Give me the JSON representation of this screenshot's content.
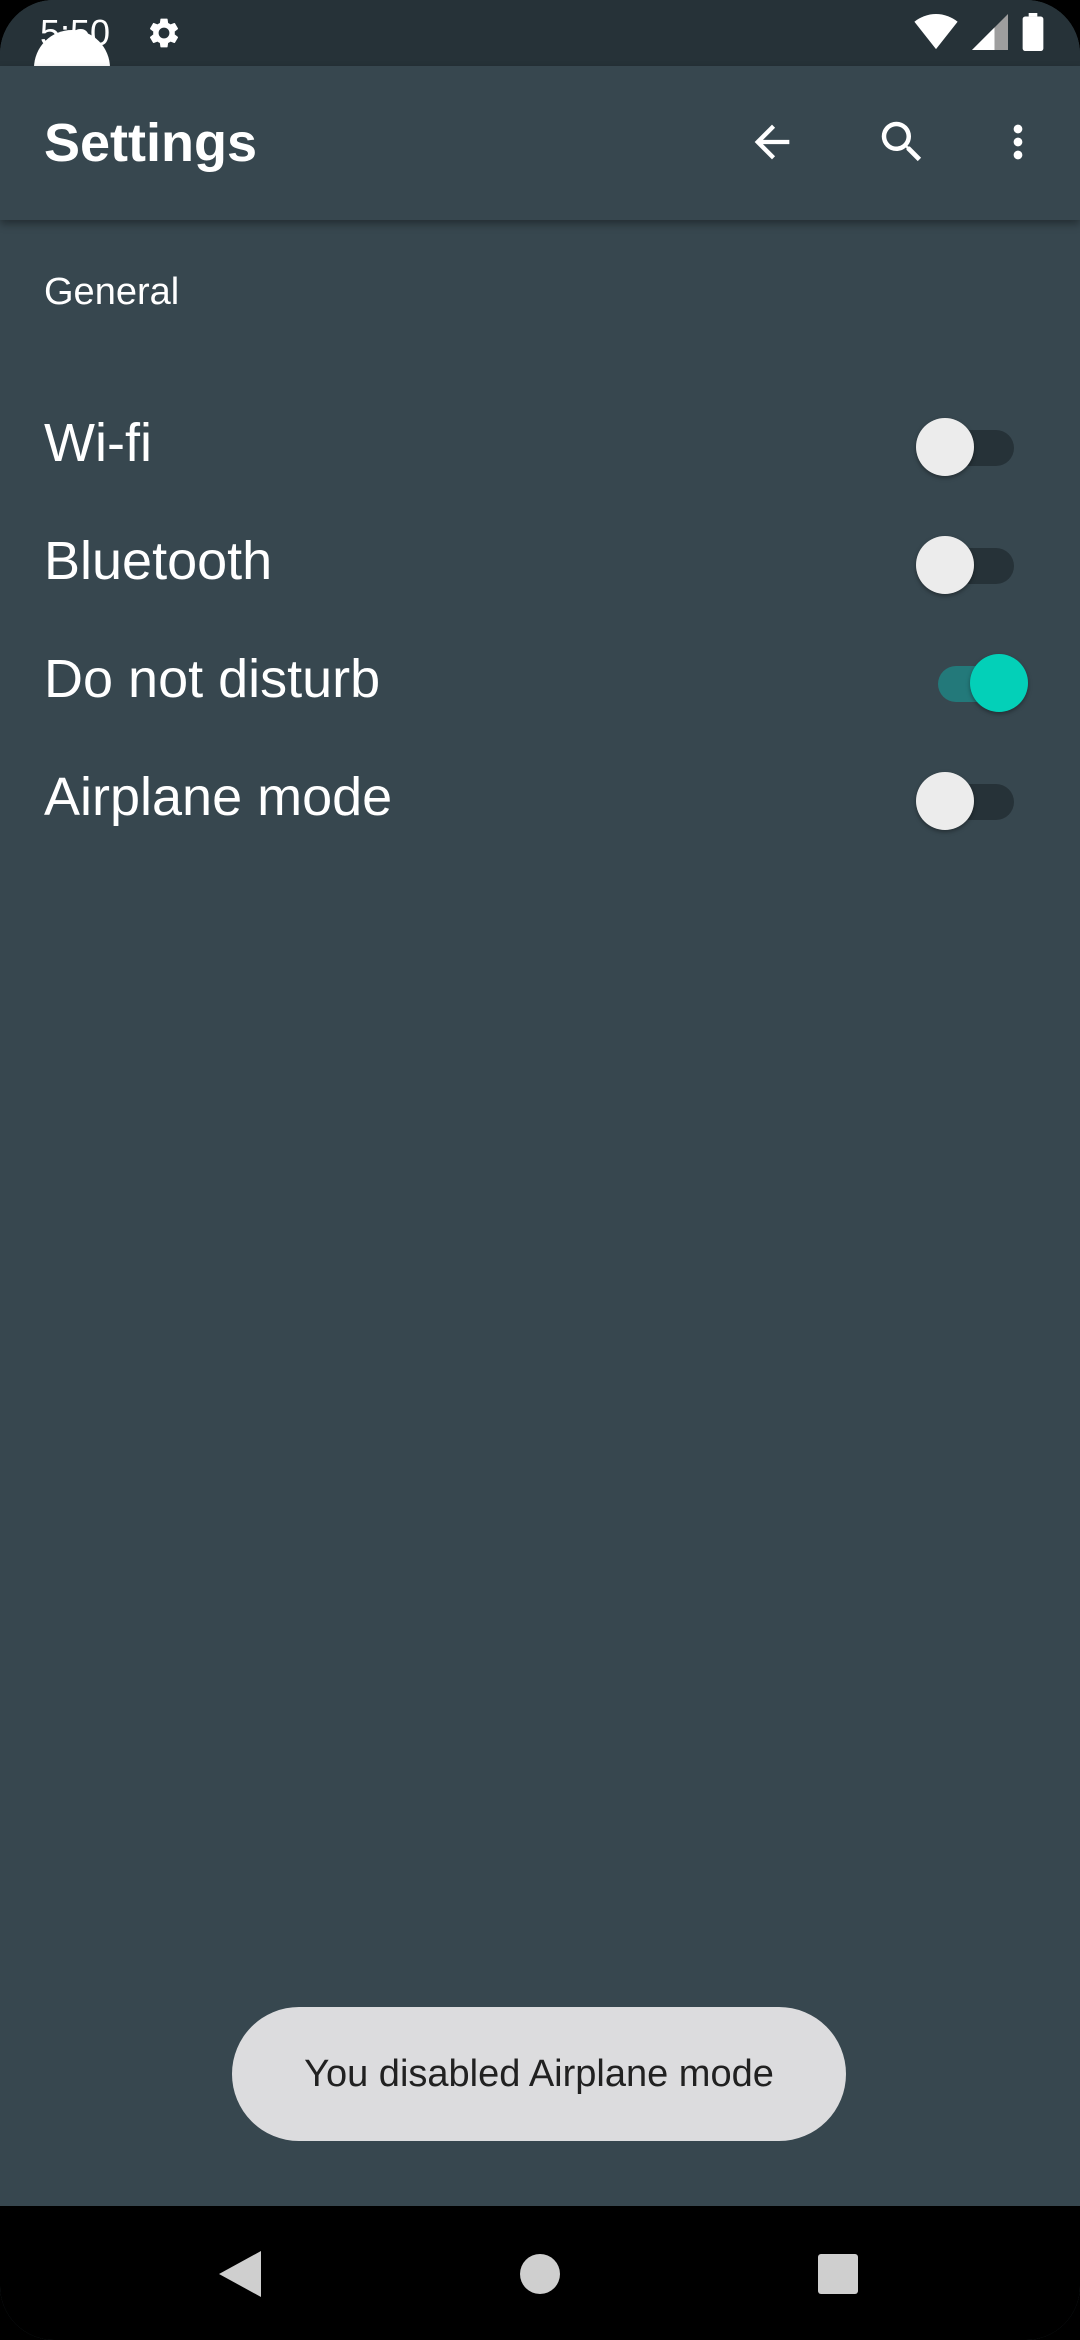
{
  "status_bar": {
    "time": "5:50",
    "icons": [
      "gear-icon",
      "wifi-icon",
      "cell-signal-icon",
      "battery-icon"
    ]
  },
  "app_bar": {
    "title": "Settings",
    "actions": [
      "back-arrow-icon",
      "search-icon",
      "more-vert-icon"
    ]
  },
  "section": {
    "header": "General"
  },
  "settings": [
    {
      "label": "Wi-fi",
      "enabled": false
    },
    {
      "label": "Bluetooth",
      "enabled": false
    },
    {
      "label": "Do not disturb",
      "enabled": true
    },
    {
      "label": "Airplane mode",
      "enabled": false
    }
  ],
  "toast": {
    "message": "You disabled Airplane mode"
  },
  "nav_bar": {
    "buttons": [
      "back-triangle-icon",
      "home-circle-icon",
      "recents-square-icon"
    ]
  },
  "colors": {
    "background": "#37474f",
    "status_bar": "#263238",
    "switch_on_thumb": "#03d0b8",
    "switch_on_track": "#23797a",
    "switch_off_thumb": "#ececec",
    "toast_bg": "#dcdcde"
  }
}
